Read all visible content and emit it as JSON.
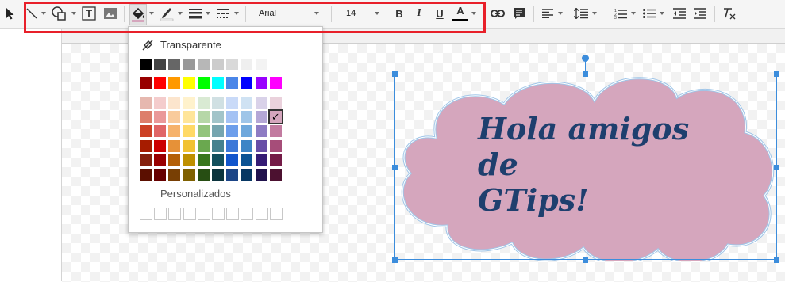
{
  "toolbar": {
    "font_name": "Arial",
    "font_size": "14",
    "bold_label": "B",
    "italic_label": "I",
    "underline_label": "U",
    "text_color_label": "A",
    "icons": [
      "select-icon",
      "line-icon",
      "shape-icon",
      "textbox-icon",
      "image-icon",
      "fill-color-icon",
      "border-color-icon",
      "border-weight-icon",
      "border-dash-icon",
      "link-icon",
      "comment-icon",
      "align-icon",
      "line-spacing-icon",
      "numbered-list-icon",
      "bulleted-list-icon",
      "decrease-indent-icon",
      "increase-indent-icon",
      "clear-formatting-icon"
    ]
  },
  "color_menu": {
    "transparent_label": "Transparente",
    "custom_label": "Personalizados",
    "grays": [
      "#000000",
      "#434343",
      "#666666",
      "#999999",
      "#b7b7b7",
      "#cccccc",
      "#d9d9d9",
      "#efefef",
      "#f3f3f3",
      "#ffffff"
    ],
    "brights": [
      "#980000",
      "#ff0000",
      "#ff9900",
      "#ffff00",
      "#00ff00",
      "#00ffff",
      "#4a86e8",
      "#0000ff",
      "#9900ff",
      "#ff00ff"
    ],
    "shades": [
      [
        "#e6b8af",
        "#f4cccc",
        "#fce5cd",
        "#fff2cc",
        "#d9ead3",
        "#d0e0e3",
        "#c9daf8",
        "#cfe2f3",
        "#d9d2e9",
        "#ead1dc"
      ],
      [
        "#dd7e6b",
        "#ea9999",
        "#f9cb9c",
        "#ffe599",
        "#b6d7a8",
        "#a2c4c9",
        "#a4c2f4",
        "#9fc5e8",
        "#b4a7d6",
        "#d5a6bd"
      ],
      [
        "#cc4125",
        "#e06666",
        "#f6b26b",
        "#ffd966",
        "#93c47d",
        "#76a5af",
        "#6d9eeb",
        "#6fa8dc",
        "#8e7cc3",
        "#c27ba0"
      ],
      [
        "#a61c00",
        "#cc0000",
        "#e69138",
        "#f1c232",
        "#6aa84f",
        "#45818e",
        "#3c78d8",
        "#3d85c6",
        "#674ea7",
        "#a64d79"
      ],
      [
        "#85200c",
        "#990000",
        "#b45f06",
        "#bf9000",
        "#38761d",
        "#134f5c",
        "#1155cc",
        "#0b5394",
        "#351c75",
        "#741b47"
      ],
      [
        "#5b0f00",
        "#660000",
        "#783f04",
        "#7f6000",
        "#274e13",
        "#0c343d",
        "#1c4587",
        "#073763",
        "#20124d",
        "#4c1130"
      ]
    ],
    "selected_mark": "✓",
    "colors": {
      "fill_current": "#d5a6bd",
      "text_current": "#000000",
      "highlight_box": "#e8202a"
    }
  },
  "shape": {
    "text_line1": "Hola amigos de",
    "text_line2": "GTips!",
    "fill": "#d5a6bd",
    "outline": "#9fc5e8",
    "text_color": "#1e3f6e"
  },
  "font_menu": {
    "selected": "Arial"
  }
}
